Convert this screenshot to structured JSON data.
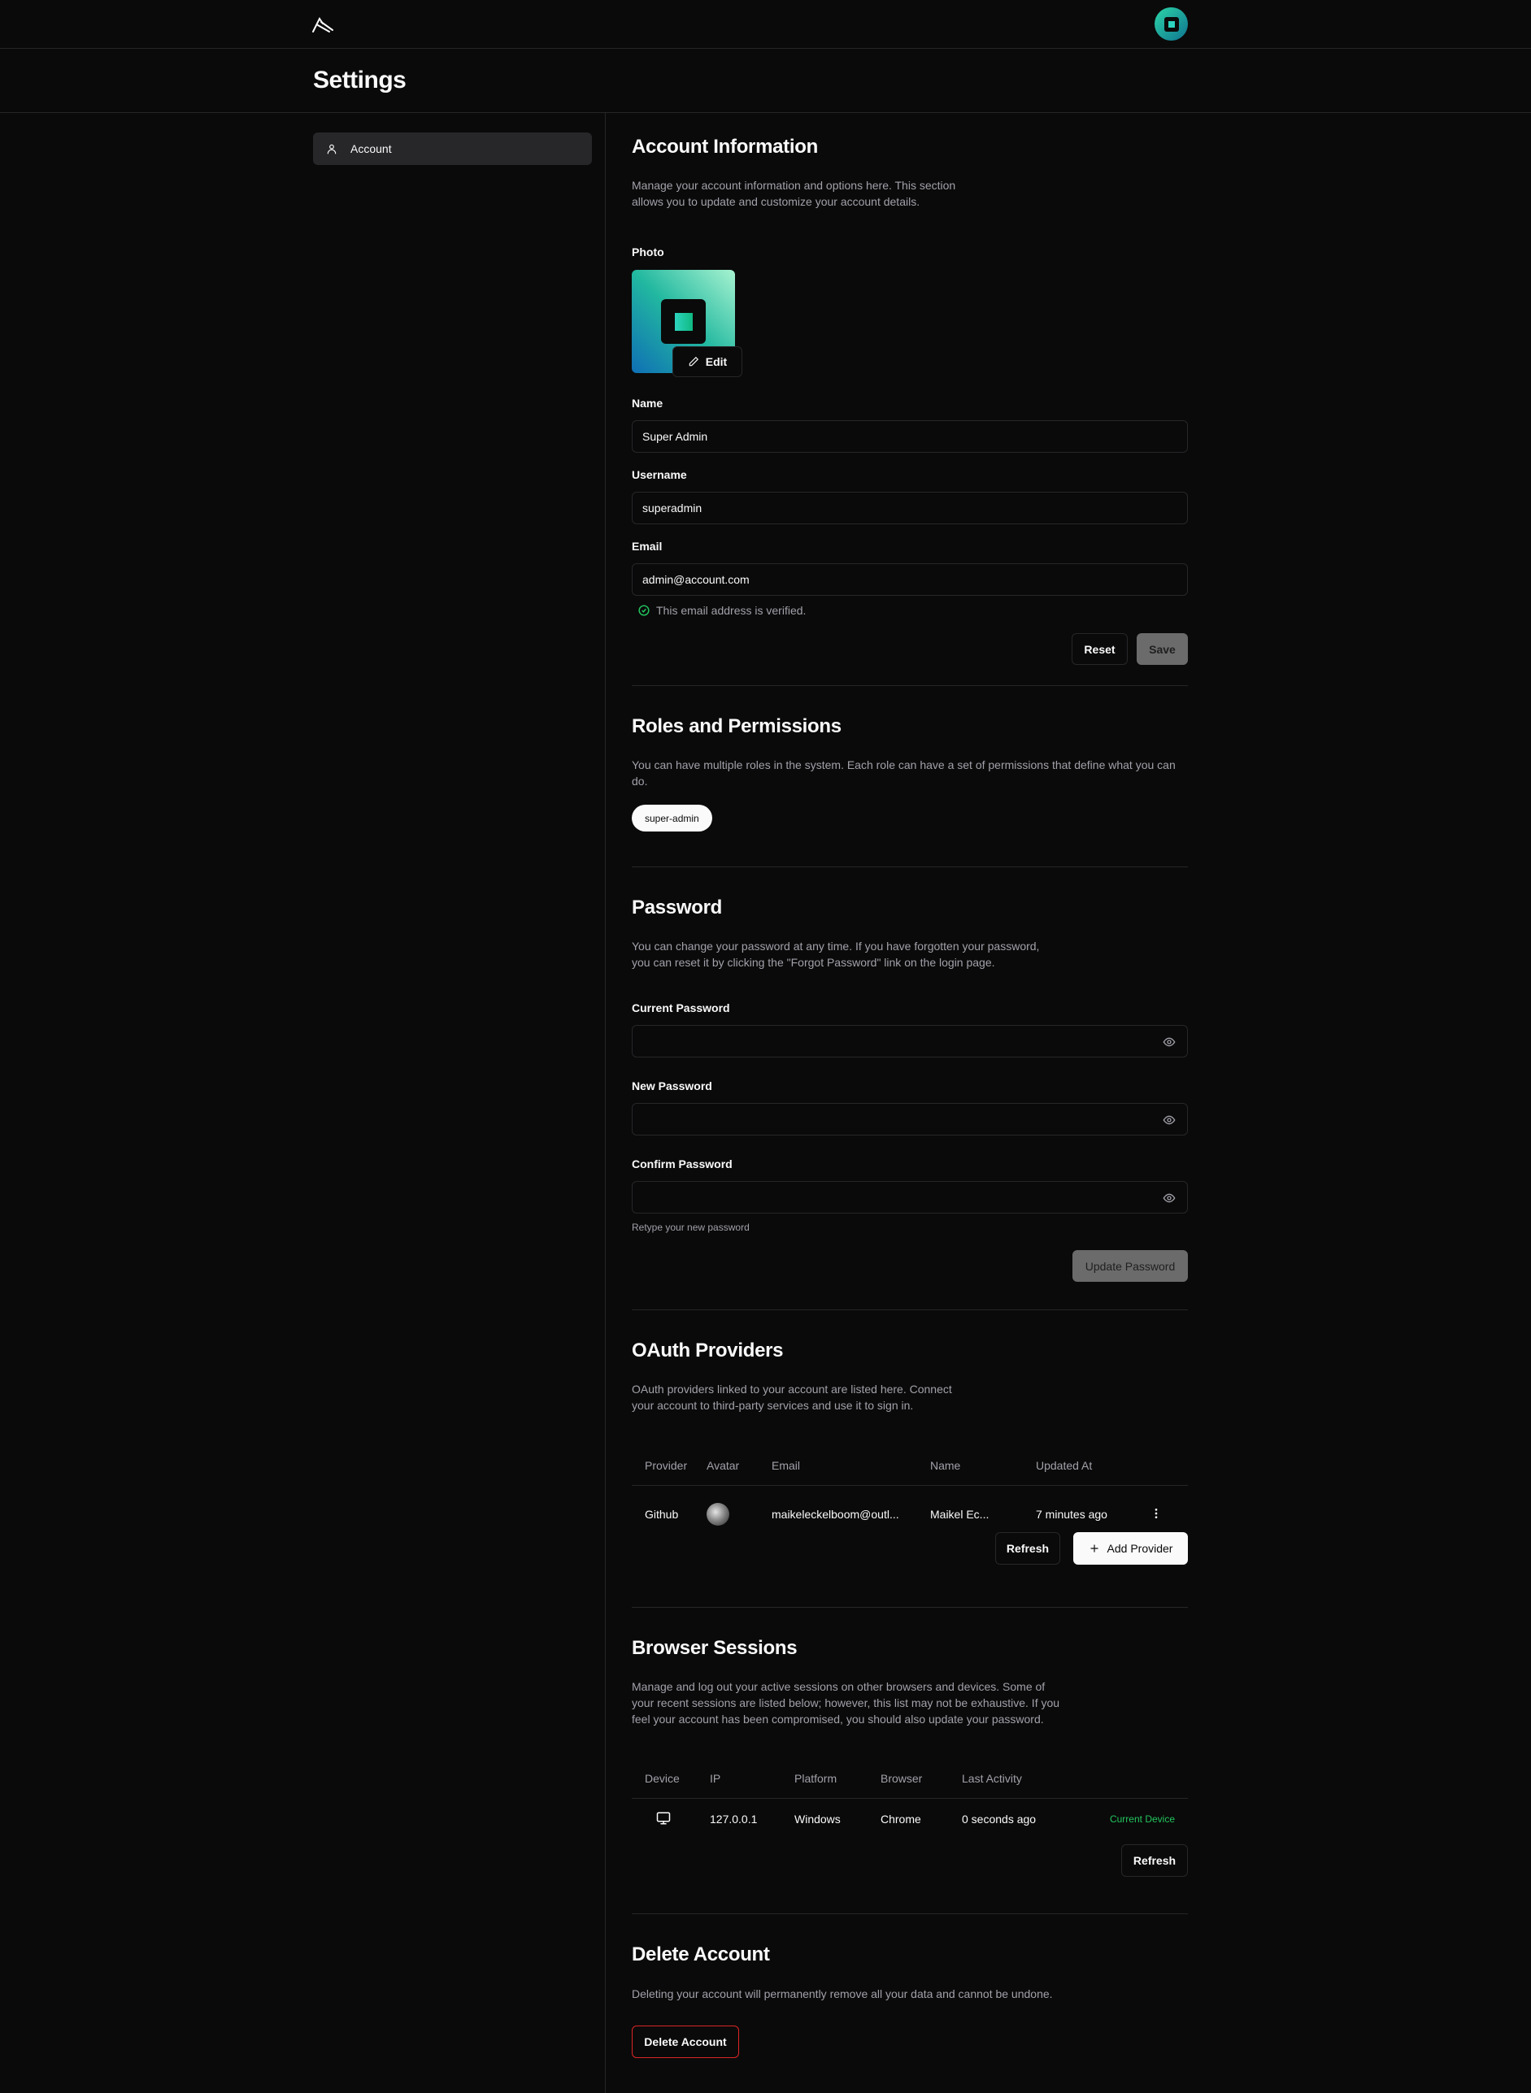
{
  "colors": {
    "background": "#0a0a0a",
    "border": "#262626",
    "muted_text": "#a1a1aa",
    "verified_green": "#22c55e",
    "danger": "#dc2626",
    "accent_teal": "#2dd4bf"
  },
  "topbar": {
    "logo_icon": "logo-icon",
    "avatar_icon": "user-avatar"
  },
  "header": {
    "title": "Settings"
  },
  "sidebar": {
    "items": [
      {
        "label": "Account",
        "icon": "user-icon"
      }
    ]
  },
  "account_info": {
    "title": "Account Information",
    "description_line1": "Manage your account information and options here. This section",
    "description_line2": "allows you to update and customize your account details.",
    "photo_label": "Photo",
    "edit_label": "Edit",
    "name_label": "Name",
    "name_value": "Super Admin",
    "username_label": "Username",
    "username_value": "superadmin",
    "email_label": "Email",
    "email_value": "admin@account.com",
    "verified_text": "This email address is verified.",
    "reset_label": "Reset",
    "save_label": "Save"
  },
  "roles": {
    "title": "Roles and Permissions",
    "description": "You can have multiple roles in the system. Each role can have a set of permissions that define what you can do.",
    "badges": [
      "super-admin"
    ]
  },
  "password": {
    "title": "Password",
    "description_line1": "You can change your password at any time. If you have forgotten your password,",
    "description_line2": "you can reset it by clicking the \"Forgot Password\" link on the login page.",
    "current_label": "Current Password",
    "new_label": "New Password",
    "confirm_label": "Confirm Password",
    "confirm_hint": "Retype your new password",
    "update_label": "Update Password"
  },
  "oauth": {
    "title": "OAuth Providers",
    "description_line1": "OAuth providers linked to your account are listed here. Connect",
    "description_line2": "your account to third-party services and use it to sign in.",
    "columns": [
      "Provider",
      "Avatar",
      "Email",
      "Name",
      "Updated At"
    ],
    "rows": [
      {
        "provider": "Github",
        "email": "maikeleckelboom@outl...",
        "name": "Maikel Ec...",
        "updated_at": "7 minutes ago"
      }
    ],
    "refresh_label": "Refresh",
    "add_label": "Add Provider"
  },
  "sessions": {
    "title": "Browser Sessions",
    "description_line1": "Manage and log out your active sessions on other browsers and devices. Some of",
    "description_line2": "your recent sessions are listed below; however, this list may not be exhaustive. If you",
    "description_line3": "feel your account has been compromised, you should also update your password.",
    "columns": [
      "Device",
      "IP",
      "Platform",
      "Browser",
      "Last Activity"
    ],
    "rows": [
      {
        "ip": "127.0.0.1",
        "platform": "Windows",
        "browser": "Chrome",
        "last_activity": "0 seconds ago",
        "badge": "Current Device"
      }
    ],
    "refresh_label": "Refresh"
  },
  "delete": {
    "title": "Delete Account",
    "description": "Deleting your account will permanently remove all your data and cannot be undone.",
    "button_label": "Delete Account"
  }
}
